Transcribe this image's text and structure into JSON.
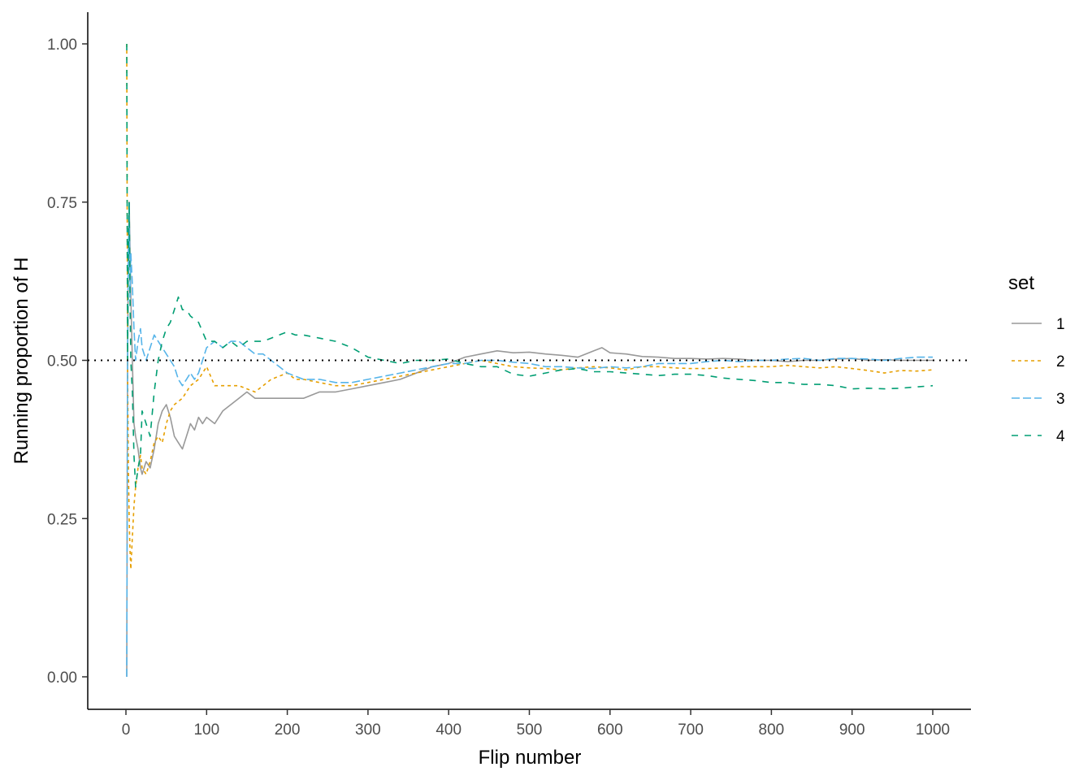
{
  "chart_data": {
    "type": "line",
    "title": "",
    "xlabel": "Flip number",
    "ylabel": "Running proportion of H",
    "xlim": [
      -47,
      1047
    ],
    "ylim": [
      -0.05,
      1.05
    ],
    "xticks": [
      0,
      100,
      200,
      300,
      400,
      500,
      600,
      700,
      800,
      900,
      1000
    ],
    "xtick_labels": [
      "0",
      "100",
      "200",
      "300",
      "400",
      "500",
      "600",
      "700",
      "800",
      "900",
      "1000"
    ],
    "yticks": [
      0,
      0.25,
      0.5,
      0.75,
      1.0
    ],
    "ytick_labels": [
      "0.00",
      "0.25",
      "0.50",
      "0.75",
      "1.00"
    ],
    "grid": false,
    "reference_line": {
      "y": 0.5,
      "style": "dotted",
      "color": "#000000"
    },
    "legend": {
      "title": "set",
      "position": "right"
    },
    "series": [
      {
        "name": "1",
        "color": "#999999",
        "linestyle": "solid",
        "x": [
          1,
          2,
          3,
          4,
          6,
          8,
          10,
          12,
          15,
          18,
          20,
          25,
          30,
          35,
          40,
          45,
          50,
          55,
          60,
          65,
          70,
          75,
          80,
          85,
          90,
          95,
          100,
          110,
          120,
          130,
          140,
          150,
          160,
          170,
          180,
          190,
          200,
          220,
          240,
          260,
          280,
          300,
          320,
          340,
          360,
          380,
          400,
          420,
          440,
          460,
          480,
          500,
          520,
          540,
          560,
          580,
          590,
          600,
          620,
          640,
          660,
          680,
          700,
          720,
          740,
          760,
          780,
          800,
          820,
          840,
          860,
          880,
          900,
          920,
          940,
          960,
          980,
          1000
        ],
        "y": [
          0,
          0.5,
          0.67,
          0.75,
          0.6,
          0.5,
          0.4,
          0.38,
          0.36,
          0.33,
          0.32,
          0.34,
          0.33,
          0.36,
          0.4,
          0.42,
          0.43,
          0.41,
          0.38,
          0.37,
          0.36,
          0.38,
          0.4,
          0.39,
          0.41,
          0.4,
          0.41,
          0.4,
          0.42,
          0.43,
          0.44,
          0.45,
          0.44,
          0.44,
          0.44,
          0.44,
          0.44,
          0.44,
          0.45,
          0.45,
          0.455,
          0.46,
          0.465,
          0.47,
          0.48,
          0.49,
          0.495,
          0.505,
          0.51,
          0.515,
          0.512,
          0.513,
          0.51,
          0.508,
          0.505,
          0.515,
          0.52,
          0.512,
          0.51,
          0.506,
          0.505,
          0.503,
          0.503,
          0.502,
          0.503,
          0.502,
          0.5,
          0.5,
          0.498,
          0.5,
          0.5,
          0.502,
          0.503,
          0.5,
          0.501,
          0.5,
          0.5,
          0.5
        ]
      },
      {
        "name": "2",
        "color": "#E69F00",
        "linestyle": "dotted",
        "x": [
          1,
          2,
          3,
          4,
          5,
          6,
          8,
          10,
          12,
          15,
          18,
          20,
          25,
          30,
          35,
          40,
          45,
          50,
          55,
          60,
          70,
          80,
          90,
          100,
          110,
          120,
          130,
          140,
          150,
          160,
          170,
          180,
          190,
          200,
          210,
          220,
          240,
          260,
          280,
          300,
          320,
          340,
          360,
          380,
          400,
          420,
          440,
          460,
          480,
          500,
          520,
          540,
          560,
          580,
          600,
          620,
          640,
          660,
          680,
          700,
          720,
          740,
          760,
          780,
          800,
          820,
          840,
          860,
          880,
          900,
          920,
          940,
          960,
          980,
          1000
        ],
        "y": [
          1.0,
          0.5,
          0.33,
          0.25,
          0.2,
          0.17,
          0.22,
          0.27,
          0.3,
          0.33,
          0.35,
          0.33,
          0.32,
          0.34,
          0.37,
          0.38,
          0.37,
          0.4,
          0.42,
          0.43,
          0.44,
          0.46,
          0.47,
          0.49,
          0.46,
          0.46,
          0.46,
          0.46,
          0.455,
          0.45,
          0.46,
          0.47,
          0.475,
          0.48,
          0.47,
          0.47,
          0.465,
          0.46,
          0.46,
          0.465,
          0.47,
          0.475,
          0.48,
          0.485,
          0.49,
          0.495,
          0.5,
          0.495,
          0.49,
          0.488,
          0.487,
          0.485,
          0.488,
          0.49,
          0.488,
          0.485,
          0.49,
          0.49,
          0.488,
          0.487,
          0.487,
          0.488,
          0.49,
          0.49,
          0.49,
          0.492,
          0.49,
          0.488,
          0.49,
          0.487,
          0.484,
          0.48,
          0.484,
          0.483,
          0.485
        ]
      },
      {
        "name": "3",
        "color": "#56B4E9",
        "linestyle": "dashed",
        "x": [
          1,
          2,
          3,
          4,
          5,
          6,
          8,
          10,
          12,
          15,
          18,
          20,
          25,
          30,
          35,
          40,
          45,
          50,
          55,
          60,
          65,
          70,
          75,
          80,
          85,
          90,
          95,
          100,
          110,
          120,
          130,
          140,
          150,
          160,
          170,
          180,
          190,
          200,
          220,
          240,
          260,
          280,
          300,
          320,
          340,
          360,
          380,
          400,
          420,
          440,
          460,
          480,
          500,
          520,
          540,
          560,
          580,
          600,
          620,
          640,
          660,
          680,
          700,
          720,
          740,
          760,
          780,
          800,
          820,
          840,
          860,
          880,
          900,
          920,
          940,
          960,
          980,
          1000
        ],
        "y": [
          0,
          0.5,
          0.67,
          0.75,
          0.6,
          0.67,
          0.62,
          0.55,
          0.5,
          0.53,
          0.55,
          0.52,
          0.5,
          0.52,
          0.54,
          0.53,
          0.52,
          0.51,
          0.5,
          0.49,
          0.47,
          0.46,
          0.47,
          0.48,
          0.47,
          0.48,
          0.5,
          0.52,
          0.53,
          0.52,
          0.53,
          0.53,
          0.52,
          0.51,
          0.51,
          0.5,
          0.49,
          0.48,
          0.47,
          0.47,
          0.465,
          0.465,
          0.47,
          0.475,
          0.48,
          0.485,
          0.49,
          0.495,
          0.495,
          0.5,
          0.5,
          0.497,
          0.495,
          0.49,
          0.49,
          0.488,
          0.487,
          0.49,
          0.488,
          0.49,
          0.495,
          0.495,
          0.495,
          0.498,
          0.5,
          0.498,
          0.5,
          0.5,
          0.502,
          0.503,
          0.5,
          0.503,
          0.503,
          0.502,
          0.5,
          0.503,
          0.505,
          0.505
        ]
      },
      {
        "name": "4",
        "color": "#009E73",
        "linestyle": "longdash",
        "x": [
          1,
          2,
          3,
          4,
          5,
          6,
          8,
          10,
          12,
          15,
          18,
          20,
          25,
          30,
          35,
          40,
          45,
          50,
          55,
          60,
          65,
          70,
          75,
          80,
          90,
          100,
          110,
          120,
          130,
          140,
          150,
          160,
          170,
          180,
          190,
          200,
          210,
          220,
          240,
          260,
          280,
          300,
          320,
          340,
          360,
          380,
          400,
          420,
          440,
          460,
          480,
          500,
          520,
          540,
          560,
          580,
          600,
          620,
          640,
          660,
          680,
          700,
          720,
          740,
          760,
          780,
          800,
          820,
          840,
          860,
          880,
          900,
          920,
          940,
          960,
          980,
          1000
        ],
        "y": [
          1.0,
          0.5,
          0.67,
          0.75,
          0.6,
          0.5,
          0.45,
          0.35,
          0.3,
          0.33,
          0.35,
          0.42,
          0.4,
          0.38,
          0.45,
          0.5,
          0.53,
          0.55,
          0.56,
          0.58,
          0.6,
          0.58,
          0.58,
          0.57,
          0.56,
          0.53,
          0.53,
          0.52,
          0.53,
          0.52,
          0.53,
          0.53,
          0.53,
          0.535,
          0.54,
          0.545,
          0.54,
          0.54,
          0.535,
          0.53,
          0.52,
          0.505,
          0.5,
          0.495,
          0.5,
          0.5,
          0.502,
          0.495,
          0.49,
          0.49,
          0.478,
          0.475,
          0.48,
          0.485,
          0.487,
          0.482,
          0.482,
          0.48,
          0.478,
          0.476,
          0.478,
          0.478,
          0.476,
          0.472,
          0.47,
          0.468,
          0.465,
          0.465,
          0.462,
          0.462,
          0.46,
          0.455,
          0.456,
          0.455,
          0.456,
          0.458,
          0.46
        ]
      }
    ]
  }
}
